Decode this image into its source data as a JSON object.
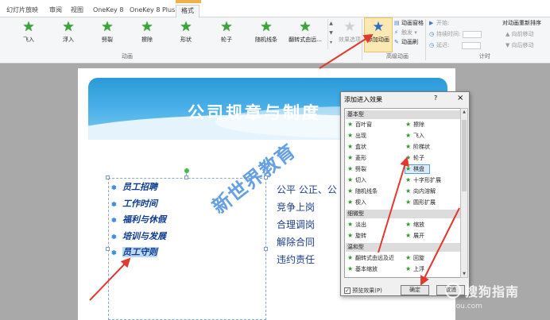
{
  "ribbon": {
    "tabs": [
      "幻灯片放映",
      "审阅",
      "视图",
      "OneKey 8",
      "OneKey 8 Plus",
      "格式"
    ],
    "active_tab_index": 5,
    "animation_gallery": [
      {
        "label": "飞入",
        "icon": "green-star-icon"
      },
      {
        "label": "浮入",
        "icon": "green-star-icon"
      },
      {
        "label": "劈裂",
        "icon": "green-star-icon"
      },
      {
        "label": "擦除",
        "icon": "green-star-icon"
      },
      {
        "label": "形状",
        "icon": "green-star-icon"
      },
      {
        "label": "轮子",
        "icon": "green-star-icon"
      },
      {
        "label": "随机线条",
        "icon": "green-star-icon"
      },
      {
        "label": "翻转式由远...",
        "icon": "green-star-icon"
      }
    ],
    "effect_options_label": "效果选项",
    "animation_group_label": "动画",
    "add_animation_label": "添加动画",
    "advanced_group_label": "高级动画",
    "animation_pane_label": "动画窗格",
    "trigger_label": "触发 ▾",
    "anim_painter_label": "动画刷",
    "start_label": "开始:",
    "duration_label": "持续时间:",
    "delay_label": "延迟:",
    "timing_group_label": "计时",
    "reorder_label": "对动画重新排序",
    "move_earlier_label": "▲ 向前移动",
    "move_later_label": "▼ 向后移动"
  },
  "slide": {
    "title": "公司规章与制度",
    "bullets": [
      "员工招聘",
      "工作时间",
      "福利与休假",
      "培训与发展",
      "员工守则"
    ],
    "selected_bullet_index": 4,
    "right_lines": [
      "公平 公正、公",
      "竞争上岗",
      "合理调岗",
      "解除合同",
      "违约责任"
    ],
    "watermark_text": "新世界教育"
  },
  "dialog": {
    "title": "添加进入效果",
    "help": "?",
    "close": "×",
    "categories": [
      "基本型",
      "细微型",
      "温和型"
    ],
    "basic_items": [
      [
        "百叶窗",
        "擦除"
      ],
      [
        "出现",
        "飞入"
      ],
      [
        "盒状",
        "阶梯状"
      ],
      [
        "菱形",
        "轮子"
      ],
      [
        "劈裂",
        "棋盘"
      ],
      [
        "切入",
        "十字形扩展"
      ],
      [
        "随机线条",
        "向内溶解"
      ],
      [
        "楔入",
        "圆形扩展"
      ]
    ],
    "subtle_items": [
      [
        "淡出",
        "缩放"
      ],
      [
        "旋转",
        "展开"
      ]
    ],
    "moderate_items": [
      [
        "翻转式由远及近",
        "回旋"
      ],
      [
        "基本缩放",
        "上浮"
      ]
    ],
    "selected_item": "棋盘",
    "preview_label": "预览效果(P)",
    "ok_label": "确定",
    "cancel_label": "取消"
  },
  "watermark": {
    "brand": "搜狗指南",
    "url": "zhinan.sogou.com"
  },
  "colors": {
    "accent_red": "#e03a2f",
    "slide_title_bg": "#2a9ad8",
    "bullet_text": "#0c3a8e"
  }
}
